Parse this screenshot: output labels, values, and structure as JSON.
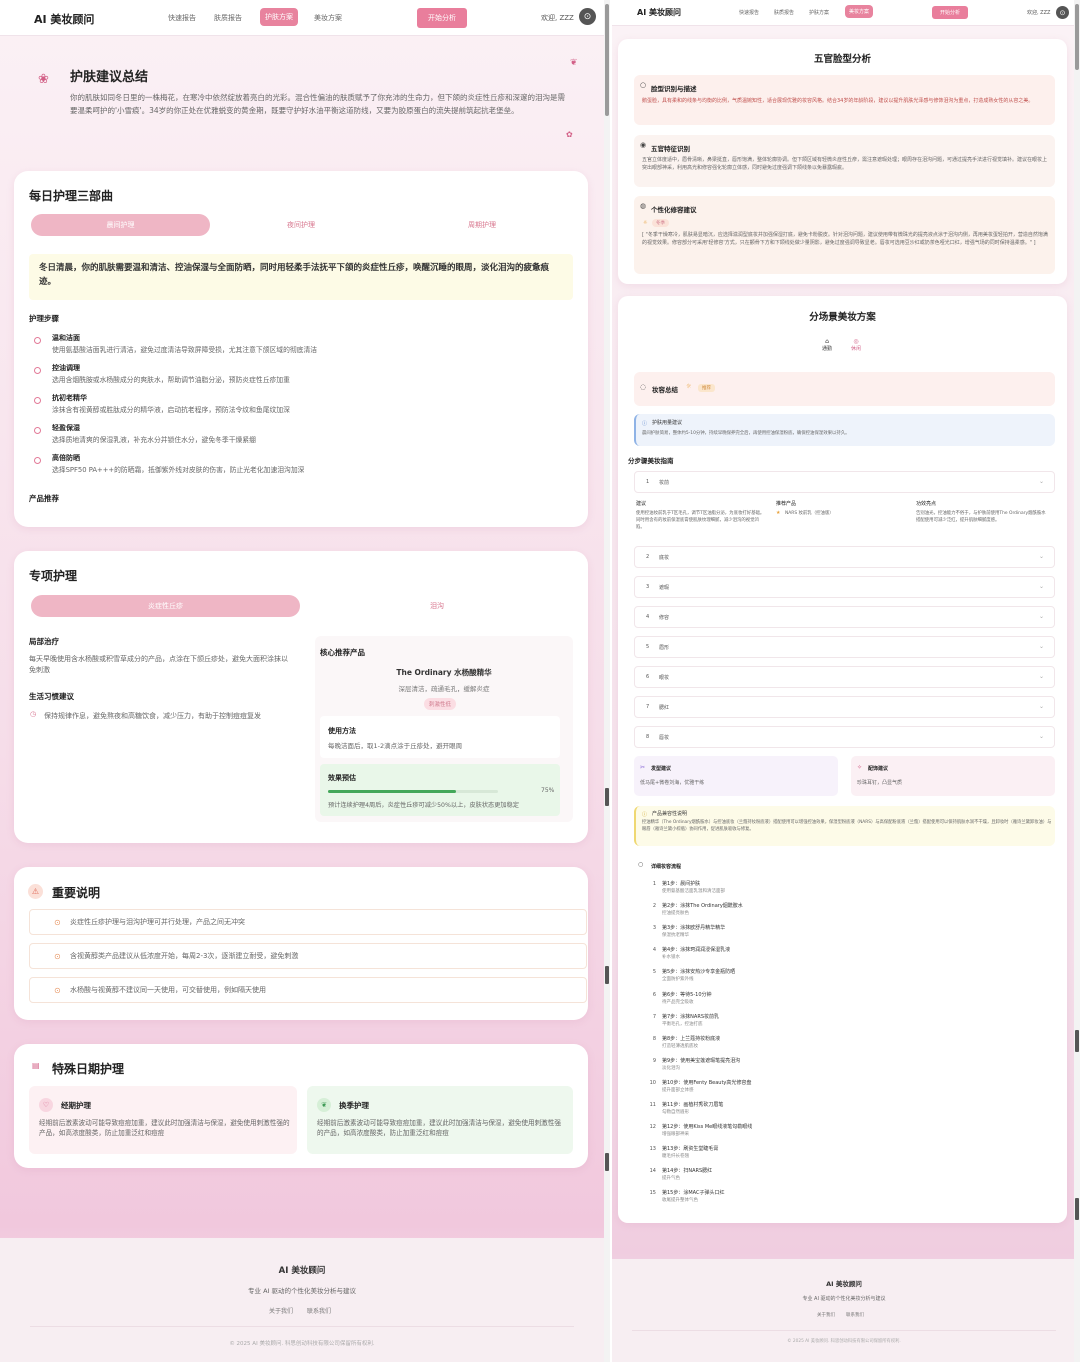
{
  "app": {
    "brand": "AI 美妆顾问",
    "welcome": "欢迎, ZZZ",
    "avatar_icon": "user-icon",
    "start_label": "开始分析"
  },
  "nav": [
    "快速报告",
    "肤质报告",
    "护肤方案",
    "美妆方案"
  ],
  "summary": {
    "title": "护肤建议总结",
    "text": "你的肌肤如同冬日里的一株梅花，在寒冷中依然绽放着亮白的光彩。混合性偏油的肤质赋予了你充沛的生命力，但下颌的炎症性丘疹和深邃的泪沟是需要温柔呵护的'小雪痕'。34岁的你正处在优雅蜕变的黄金期，既要守护好水油平衡这道防线，又要为胶原蛋白的流失提前筑起抗老堡垒。"
  },
  "daily": {
    "title": "每日护理三部曲",
    "tabs": [
      "晨间护理",
      "夜间护理",
      "周期护理"
    ],
    "highlight": "冬日清晨，你的肌肤需要温和清洁、控油保湿与全面防晒，同时用轻柔手法抚平下颌的炎症性丘疹，唤醒沉睡的眼周，淡化泪沟的疲惫痕迹。",
    "steps_title": "护理步骤",
    "steps": [
      {
        "name": "温和洁面",
        "desc": "使用氨基酸洁面乳进行清洁，避免过度清洁导致屏障受损，尤其注意下颌区域的彻底清洁"
      },
      {
        "name": "控油调理",
        "desc": "选用含烟酰胺或水杨酸成分的爽肤水，帮助调节油脂分泌，预防炎症性丘疹加重"
      },
      {
        "name": "抗初老精华",
        "desc": "涂抹含有视黄醇或胜肽成分的精华液，启动抗老程序，预防法令纹和鱼尾纹加深"
      },
      {
        "name": "轻盈保湿",
        "desc": "选择质地清爽的保湿乳液，补充水分并锁住水分，避免冬季干燥紧绷"
      },
      {
        "name": "高倍防晒",
        "desc": "选择SPF50 PA+++的防晒霜，抵御紫外线对皮肤的伤害，防止光老化加速泪沟加深"
      }
    ],
    "products_title": "产品推荐"
  },
  "special": {
    "title": "专项护理",
    "tabs": [
      "炎症性丘疹",
      "泪沟"
    ],
    "local_title": "局部治疗",
    "local_text": "每天早晚使用含水杨酸或积雪草成分的产品，点涂在下颌丘疹处，避免大面积涂抹以免刺激",
    "habit_title": "生活习惯建议",
    "habit_text": "保持规律作息，避免熬夜和高糖饮食，减少压力，有助于控制痘痘复发",
    "core_title": "核心推荐产品",
    "product_name": "The Ordinary 水杨酸精华",
    "product_desc": "深层清洁，疏通毛孔，缓解炎症",
    "product_tag": "刺激性低",
    "usage_title": "使用方法",
    "usage_text": "每晚洁面后，取1-2滴点涂于丘疹处，避开眼周",
    "effect_title": "效果预估",
    "effect_percent": "75%",
    "effect_value": 0.75,
    "effect_text": "预计连续护理4周后，炎症性丘疹可减少50%以上，皮肤状态更加稳定"
  },
  "important": {
    "title": "重要说明",
    "items": [
      "炎症性丘疹护理与泪沟护理可并行处理，产品之间无冲突",
      "含视黄醇类产品建议从低浓度开始，每周2-3次，逐渐建立耐受，避免刺激",
      "水杨酸与视黄醇不建议同一天使用，可交替使用，例如隔天使用"
    ]
  },
  "special_days": {
    "title": "特殊日期护理",
    "cards": [
      {
        "title": "经期护理",
        "text": "经期前后激素波动可能导致痘痘加重，建议此时加强清洁与保湿，避免使用刺激性强的产品，如高浓度酸类，防止加重泛红和痘痘"
      },
      {
        "title": "换季护理",
        "text": "经期前后激素波动可能导致痘痘加重，建议此时加强清洁与保湿，避免使用刺激性强的产品，如高浓度酸类，防止加重泛红和痘痘"
      }
    ]
  },
  "footer": {
    "brand": "AI 美妆顾问",
    "tagline": "专业 AI 驱动的个性化美妆分析与建议",
    "about": "关于我们",
    "contact": "联系我们",
    "copyright": "© 2025 AI 美妆顾问. 科思创动科技有限公司保留所有权利."
  },
  "face": {
    "title": "五官脸型分析",
    "recog_title": "脸型识别与描述",
    "recog_text": "鹅蛋脸，具有柔和的线条与均衡的比例，气质温婉知性，适合展现优雅的妆容风格。结合34岁的年龄阶段，建议以提升肌肤光泽感与修饰泪沟为重点，打造成熟女性的从容之美。",
    "feat_title": "五官特征识别",
    "feat_text": "五官立体度适中，眉骨清晰，鼻梁挺直，唇形饱满，整体轮廓协调。但下颌区域有轻微炎症性丘疹，需注意遮瑕处理；眼周存在泪沟问题，可通过提亮手法进行视觉填补。建议在眼妆上突出眼部神采，利用高光和修容强化轮廓立体感，同时避免过度强调下颌线条以免暴露瑕疵。",
    "mod_title": "个性化修容建议",
    "mod_tag": "冬季",
    "mod_text": "[ \"冬季干燥寒冷，肌肤易显暗沉，应选择滋润型底妆并加强保湿打底，避免卡粉脱皮。针对泪沟问题，建议使用带有微珠光的提亮液点涂于泪沟内侧，再用美妆蛋轻拍开，营造自然饱满的视觉效果。修容部分可采用'轻修容'方式，只在颧骨下方和下颌线处做少量阴影，避免过度强调导致显老。唇妆可选用豆沙红或奶茶色哑光口红，增强气场的同时保持温柔感。\" ]"
  },
  "scene": {
    "title": "分场景美妆方案",
    "tabs": [
      "通勤",
      "休闲"
    ],
    "summary_title": "妆容总结",
    "summary_tag": "推荐",
    "tip_title": "护肤用量建议",
    "tip_text": "晨间护肤简易，整体约5-10分钟，持续早晚保养完全后，再使用控油保湿粉底，确保控油保湿效果以持久。",
    "guide_title": "分步骤美妆指南",
    "accordion": [
      "妆前",
      "底妆",
      "遮瑕",
      "修容",
      "眉形",
      "眼妆",
      "腮红",
      "唇妆"
    ],
    "open_cols": {
      "advice_label": "建议",
      "advice_text": "使用控油妆前乳于T区毛孔，调节T区油脂分泌，为底妆打好基础。同时用含有的妆前保湿底膏使肌肤纹理细腻，减少泪沟的视觉凹陷。",
      "product_label": "推荐产品",
      "product_text": "NARS 妆前乳（控油版）",
      "highlight_label": "功效亮点",
      "highlight_text": "告别油光，控油能力不俗于，与护肤前使用The Ordinary烟酰胺水搭配使用可减少泛红，提升肌肤细腻度感。"
    },
    "hair_title": "发型建议",
    "hair_text": "低马尾+微卷刘海，优雅干练",
    "acc_title": "配饰建议",
    "acc_text": "珍珠耳钉，凸显气质",
    "compat_title": "产品兼容性说明",
    "compat_text": "控油精华（The Ordinary烟酰胺水）与控油底妆（兰蔻持妆粉底液）搭配使用可以增强控油效果，保湿型粉底液（NARS）与高保配粉底液（兰蔻）搭配使用可以保持肌肤水润不干燥，且卸妆时（雅诗兰黛卸妆油）与眼唇（雅诗兰黛小棕瓶）协同作用，促进肌肤吸收与修复。",
    "flow_title": "详细妆容流程",
    "flow": [
      {
        "t": "第1步：晨间护肤",
        "s": "使用氨基酸洁面乳温和清洁面部"
      },
      {
        "t": "第2步：涂抹The Ordinary烟酰胺水",
        "s": "控油提亮肤色"
      },
      {
        "t": "第3步：涂抹欧舒丹精华精华",
        "s": "保湿抗老精华"
      },
      {
        "t": "第4步：涂抹珂润润浸保湿乳液",
        "s": "补水锁水"
      },
      {
        "t": "第5步：涂抹安热沙专享金瓶防晒",
        "s": "全面防护紫外线"
      },
      {
        "t": "第6步：等待5-10分钟",
        "s": "待产品完全吸收"
      },
      {
        "t": "第7步：涂抹NARS妆前乳",
        "s": "平衡毛孔，控油打底"
      },
      {
        "t": "第8步：上兰蔻持妆粉底液",
        "s": "打造轻薄透肌底妆"
      },
      {
        "t": "第9步：使用美宝莲遮瑕笔提亮泪沟",
        "s": "淡化泪沟"
      },
      {
        "t": "第10步：使用Fenty Beauty高光修容盘",
        "s": "提升面部立体感"
      },
      {
        "t": "第11步：画植村秀砍刀眉笔",
        "s": "勾勒自然眉形"
      },
      {
        "t": "第12步：使用Kiss Me眼线液笔勾勒眼线",
        "s": "增强眼部神采"
      },
      {
        "t": "第13步：刷资生堂睫毛膏",
        "s": "睫毛纤长卷翘"
      },
      {
        "t": "第14步：扫NARS腮红",
        "s": "提升气色"
      },
      {
        "t": "第15步：涂MAC子弹头口红",
        "s": "收尾提升整体气色"
      }
    ]
  }
}
